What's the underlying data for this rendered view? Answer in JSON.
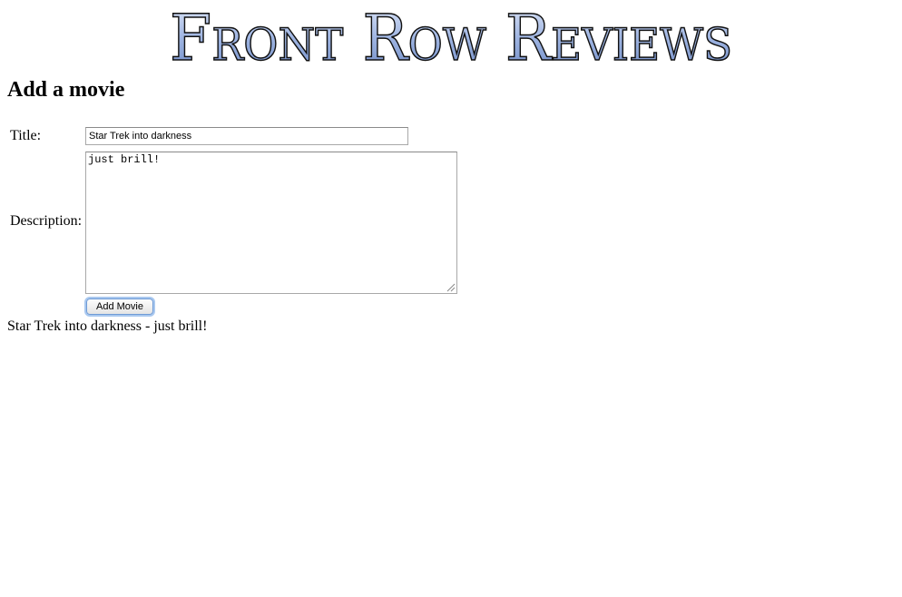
{
  "header": {
    "logo_text": "Front Row Reviews"
  },
  "page": {
    "heading": "Add a movie"
  },
  "form": {
    "title_label": "Title:",
    "title_value": "Star Trek into darkness",
    "description_label": "Description:",
    "description_value": "just brill!",
    "submit_label": "Add Movie"
  },
  "movies": [
    {
      "title": "Star Trek into darkness",
      "description": "just brill!"
    }
  ],
  "colors": {
    "logo_fill_top": "#c9d6f3",
    "logo_fill_bottom": "#6e8ac4",
    "logo_stroke": "#111111",
    "button_focus": "#6f9bd6"
  }
}
